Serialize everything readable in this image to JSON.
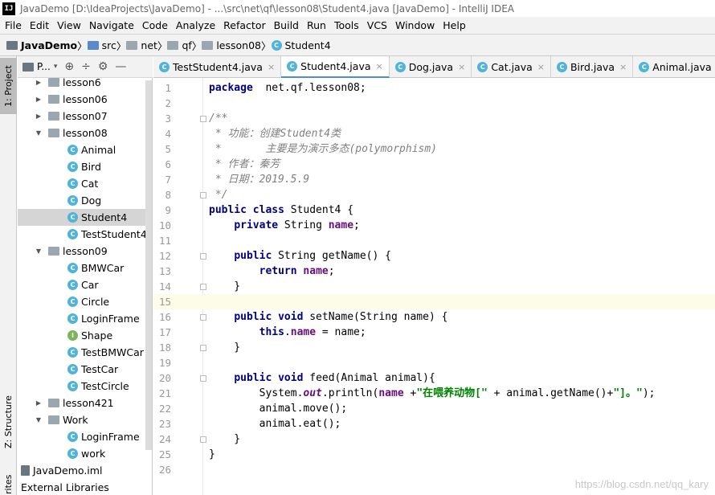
{
  "window": {
    "title": "JavaDemo [D:\\IdeaProjects\\JavaDemo] - ...\\src\\net\\qf\\lesson08\\Student4.java [JavaDemo] - IntelliJ IDEA",
    "app_icon": "IJ"
  },
  "menu": [
    "File",
    "Edit",
    "View",
    "Navigate",
    "Code",
    "Analyze",
    "Refactor",
    "Build",
    "Run",
    "Tools",
    "VCS",
    "Window",
    "Help"
  ],
  "breadcrumb": [
    "JavaDemo",
    "src",
    "net",
    "qf",
    "lesson08",
    "Student4"
  ],
  "sidebar_tabs": {
    "project": "1: Project",
    "structure": "Z: Structure",
    "favorites": "rites"
  },
  "project_panel": {
    "title": "P..."
  },
  "tree": [
    {
      "label": "lesson6",
      "type": "folder",
      "expanded": false,
      "depth": 1
    },
    {
      "label": "lesson06",
      "type": "folder",
      "expanded": false,
      "depth": 1
    },
    {
      "label": "lesson07",
      "type": "folder",
      "expanded": false,
      "depth": 1
    },
    {
      "label": "lesson08",
      "type": "folder",
      "expanded": true,
      "depth": 1
    },
    {
      "label": "Animal",
      "type": "class",
      "depth": 2
    },
    {
      "label": "Bird",
      "type": "class",
      "depth": 2
    },
    {
      "label": "Cat",
      "type": "class",
      "depth": 2
    },
    {
      "label": "Dog",
      "type": "class",
      "depth": 2
    },
    {
      "label": "Student4",
      "type": "class",
      "depth": 2,
      "selected": true
    },
    {
      "label": "TestStudent4",
      "type": "class",
      "depth": 2
    },
    {
      "label": "lesson09",
      "type": "folder",
      "expanded": true,
      "depth": 1
    },
    {
      "label": "BMWCar",
      "type": "class",
      "depth": 2
    },
    {
      "label": "Car",
      "type": "class",
      "depth": 2
    },
    {
      "label": "Circle",
      "type": "class",
      "depth": 2
    },
    {
      "label": "LoginFrame",
      "type": "class",
      "depth": 2
    },
    {
      "label": "Shape",
      "type": "interface",
      "depth": 2
    },
    {
      "label": "TestBMWCar",
      "type": "class",
      "depth": 2
    },
    {
      "label": "TestCar",
      "type": "class",
      "depth": 2
    },
    {
      "label": "TestCircle",
      "type": "class",
      "depth": 2
    },
    {
      "label": "lesson421",
      "type": "folder",
      "expanded": false,
      "depth": 1
    },
    {
      "label": "Work",
      "type": "folder",
      "expanded": true,
      "depth": 1
    },
    {
      "label": "LoginFrame",
      "type": "class",
      "depth": 2
    },
    {
      "label": "work",
      "type": "class",
      "depth": 2
    },
    {
      "label": "JavaDemo.iml",
      "type": "file",
      "depth": 0
    },
    {
      "label": "External Libraries",
      "type": "lib",
      "depth": 0
    }
  ],
  "tabs": [
    {
      "label": "TestStudent4.java",
      "active": false
    },
    {
      "label": "Student4.java",
      "active": true
    },
    {
      "label": "Dog.java",
      "active": false
    },
    {
      "label": "Cat.java",
      "active": false
    },
    {
      "label": "Bird.java",
      "active": false
    },
    {
      "label": "Animal.java",
      "active": false
    }
  ],
  "editor": {
    "current_line": 15,
    "lines": [
      {
        "n": "1",
        "tokens": [
          [
            "kw",
            "package"
          ],
          [
            "",
            "  net.qf.lesson08;"
          ]
        ]
      },
      {
        "n": "2",
        "tokens": []
      },
      {
        "n": "3",
        "fold": true,
        "tokens": [
          [
            "cm",
            "/**"
          ]
        ]
      },
      {
        "n": "4",
        "tokens": [
          [
            "cm",
            " * 功能：创建"
          ],
          [
            "cm",
            "Student4"
          ],
          [
            "cm",
            "类"
          ]
        ]
      },
      {
        "n": "5",
        "tokens": [
          [
            "cm",
            " *       主要是为演示多态(polymorphism)"
          ]
        ]
      },
      {
        "n": "6",
        "tokens": [
          [
            "cm",
            " * 作者：秦芳"
          ]
        ]
      },
      {
        "n": "7",
        "tokens": [
          [
            "cm",
            " * 日期："
          ],
          [
            "cm",
            "2019.5.9"
          ]
        ]
      },
      {
        "n": "8",
        "fold": true,
        "tokens": [
          [
            "cm",
            " */"
          ]
        ]
      },
      {
        "n": "9",
        "tokens": [
          [
            "kw",
            "public class"
          ],
          [
            "",
            " Student4 {"
          ]
        ]
      },
      {
        "n": "10",
        "tokens": [
          [
            "",
            "    "
          ],
          [
            "kw",
            "private"
          ],
          [
            "",
            " String "
          ],
          [
            "field",
            "name"
          ],
          [
            "",
            ";"
          ]
        ]
      },
      {
        "n": "11",
        "tokens": []
      },
      {
        "n": "12",
        "fold": true,
        "tokens": [
          [
            "",
            "    "
          ],
          [
            "kw",
            "public"
          ],
          [
            "",
            " String getName() {"
          ]
        ]
      },
      {
        "n": "13",
        "tokens": [
          [
            "",
            "        "
          ],
          [
            "kw",
            "return"
          ],
          [
            "field",
            " name"
          ],
          [
            "",
            ";"
          ]
        ]
      },
      {
        "n": "14",
        "fold": true,
        "tokens": [
          [
            "",
            "    }"
          ]
        ]
      },
      {
        "n": "15",
        "tokens": []
      },
      {
        "n": "16",
        "fold": true,
        "tokens": [
          [
            "",
            "    "
          ],
          [
            "kw",
            "public void"
          ],
          [
            "",
            " setName(String name) {"
          ]
        ]
      },
      {
        "n": "17",
        "tokens": [
          [
            "",
            "        "
          ],
          [
            "kw",
            "this"
          ],
          [
            "",
            "."
          ],
          [
            "field",
            "name"
          ],
          [
            "",
            " = name;"
          ]
        ]
      },
      {
        "n": "18",
        "fold": true,
        "tokens": [
          [
            "",
            "    }"
          ]
        ]
      },
      {
        "n": "19",
        "tokens": []
      },
      {
        "n": "20",
        "fold": true,
        "tokens": [
          [
            "",
            "    "
          ],
          [
            "kw",
            "public"
          ],
          [
            "",
            " "
          ],
          [
            "kw",
            "void"
          ],
          [
            "",
            " feed(Animal animal){"
          ]
        ]
      },
      {
        "n": "21",
        "tokens": [
          [
            "",
            "        System."
          ],
          [
            "st",
            "out"
          ],
          [
            "",
            ".println("
          ],
          [
            "field",
            "name"
          ],
          [
            "",
            " +"
          ],
          [
            "str",
            "\"在喂养动物[\""
          ],
          [
            "",
            " + animal.getName()+"
          ],
          [
            "str",
            "\"]。\""
          ],
          [
            "",
            ");"
          ]
        ]
      },
      {
        "n": "22",
        "tokens": [
          [
            "",
            "        animal.move();"
          ]
        ]
      },
      {
        "n": "23",
        "tokens": [
          [
            "",
            "        animal.eat();"
          ]
        ]
      },
      {
        "n": "24",
        "fold": true,
        "tokens": [
          [
            "",
            "    }"
          ]
        ]
      },
      {
        "n": "25",
        "tokens": [
          [
            "",
            "}"
          ]
        ]
      },
      {
        "n": "26",
        "tokens": []
      }
    ]
  },
  "watermark": "https://blog.csdn.net/qq_kary"
}
